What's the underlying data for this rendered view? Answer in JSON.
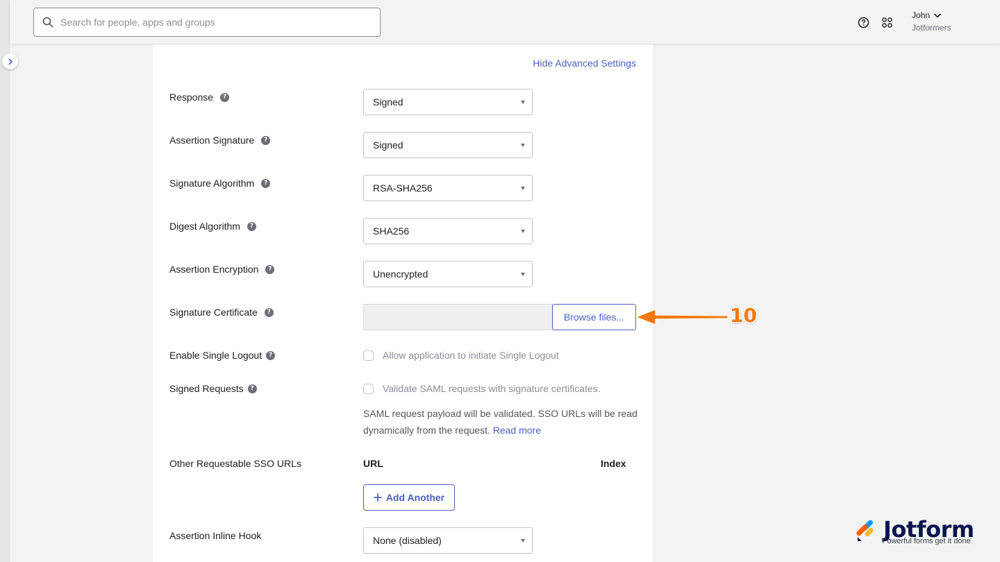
{
  "search": {
    "placeholder": "Search for people, apps and groups"
  },
  "user": {
    "name": "John",
    "org": "Jotformers"
  },
  "panel": {
    "advanced_link": "Hide Advanced Settings",
    "rows": [
      {
        "label": "Response",
        "value": "Signed"
      },
      {
        "label": "Assertion Signature",
        "value": "Signed"
      },
      {
        "label": "Signature Algorithm",
        "value": "RSA-SHA256"
      },
      {
        "label": "Digest Algorithm",
        "value": "SHA256"
      },
      {
        "label": "Assertion Encryption",
        "value": "Unencrypted"
      }
    ],
    "signature_certificate": {
      "label": "Signature Certificate",
      "button": "Browse files..."
    },
    "single_logout": {
      "label": "Enable Single Logout",
      "option": "Allow application to initiate Single Logout",
      "checked": false
    },
    "signed_requests": {
      "label": "Signed Requests",
      "option": "Validate SAML requests with signature certificates.",
      "checked": false,
      "description": "SAML request payload will be validated. SSO URLs will be read dynamically from the request.",
      "read_more": "Read more"
    },
    "sso_urls": {
      "label": "Other Requestable SSO URLs",
      "col_url": "URL",
      "col_index": "Index",
      "add_button": "Add Another"
    },
    "inline_hook": {
      "label": "Assertion Inline Hook",
      "value": "None (disabled)"
    }
  },
  "annotation": {
    "number": "10",
    "color": "#f27a0c"
  },
  "watermark": {
    "brand": "Jotform",
    "tagline": "Powerful forms get it done"
  },
  "colors": {
    "link": "#4a5fc1",
    "text": "#1d1d21",
    "muted": "#8c8c96"
  }
}
